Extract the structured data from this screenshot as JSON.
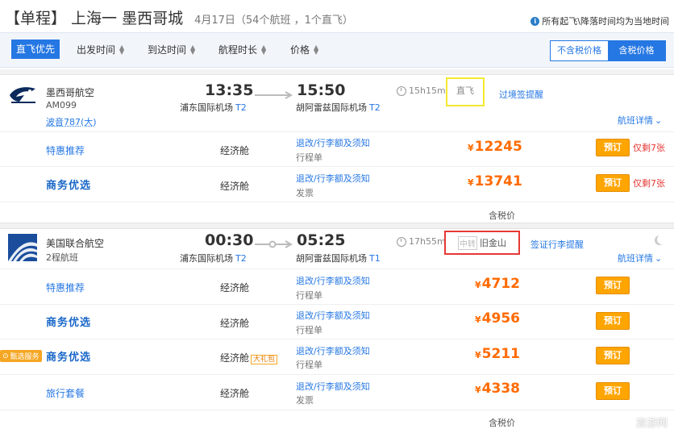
{
  "header": {
    "title": "【单程】 上海一 墨西哥城",
    "subtitle": "4月17日（54个航班 ，1个直飞）",
    "notice": "所有起飞\\降落时间均为当地时间",
    "notice_icon": "info-icon"
  },
  "sortbar": {
    "direct_first": "直飞优先",
    "items": [
      "出发时间",
      "到达时间",
      "航程时长",
      "价格"
    ],
    "tax_off": "不含税价格",
    "tax_on": "含税价格"
  },
  "flights": [
    {
      "airline": "墨西哥航空",
      "flight_no": "AM099",
      "aircraft": "波音787(大)",
      "dep_time": "13:35",
      "dep_airport": "浦东国际机场",
      "dep_term": "T2",
      "arr_time": "15:50",
      "arr_airport": "胡阿雷兹国际机场",
      "arr_term": "T2",
      "duration": "15h15m",
      "stop_text": "直飞",
      "note_link": "过境签提醒",
      "detail_link": "航班详情",
      "fares": [
        {
          "name": "特惠推荐",
          "cabin": "经济舱",
          "rule": "退改/行李额及须知",
          "doc": "行程单",
          "price": "12245",
          "book": "预订",
          "remain": "仅剩7张"
        },
        {
          "name": "商务优选",
          "cabin": "经济舱",
          "rule": "退改/行李额及须知",
          "doc": "发票",
          "price": "13741",
          "book": "预订",
          "remain": "仅剩7张"
        }
      ],
      "tax_note": "含税价"
    },
    {
      "airline": "美国联合航空",
      "flight_no": "2程航班",
      "dep_time": "00:30",
      "dep_airport": "浦东国际机场",
      "dep_term": "T2",
      "arr_time": "05:25",
      "arr_airport": "胡阿雷兹国际机场",
      "arr_term": "T1",
      "duration": "17h55m",
      "stop_tag": "中转",
      "stop_city": "旧金山",
      "note_link": "签证行李提醒",
      "detail_link": "航班详情",
      "fares": [
        {
          "name": "特惠推荐",
          "cabin": "经济舱",
          "rule": "退改/行李额及须知",
          "doc": "行程单",
          "price": "4712",
          "book": "预订"
        },
        {
          "name": "商务优选",
          "cabin": "经济舱",
          "rule": "退改/行李额及须知",
          "doc": "行程单",
          "price": "4956",
          "book": "预订"
        },
        {
          "name": "商务优选",
          "cabin": "经济舱",
          "gift": "大礼包",
          "badge": "甄选服务",
          "rule": "退改/行李额及须知",
          "doc": "行程单",
          "price": "5211",
          "book": "预订"
        },
        {
          "name": "旅行套餐",
          "cabin": "经济舱",
          "rule": "退改/行李额及须知",
          "doc": "发票",
          "price": "4338",
          "book": "预订"
        }
      ],
      "tax_note": "含税价"
    }
  ],
  "currency": "¥",
  "watermark": "旅游网",
  "colors": {
    "accent": "#2577e3",
    "price": "#ff6a00",
    "book": "#ffa500",
    "direct_highlight": "#f5e930",
    "stop_highlight": "#e53935"
  }
}
